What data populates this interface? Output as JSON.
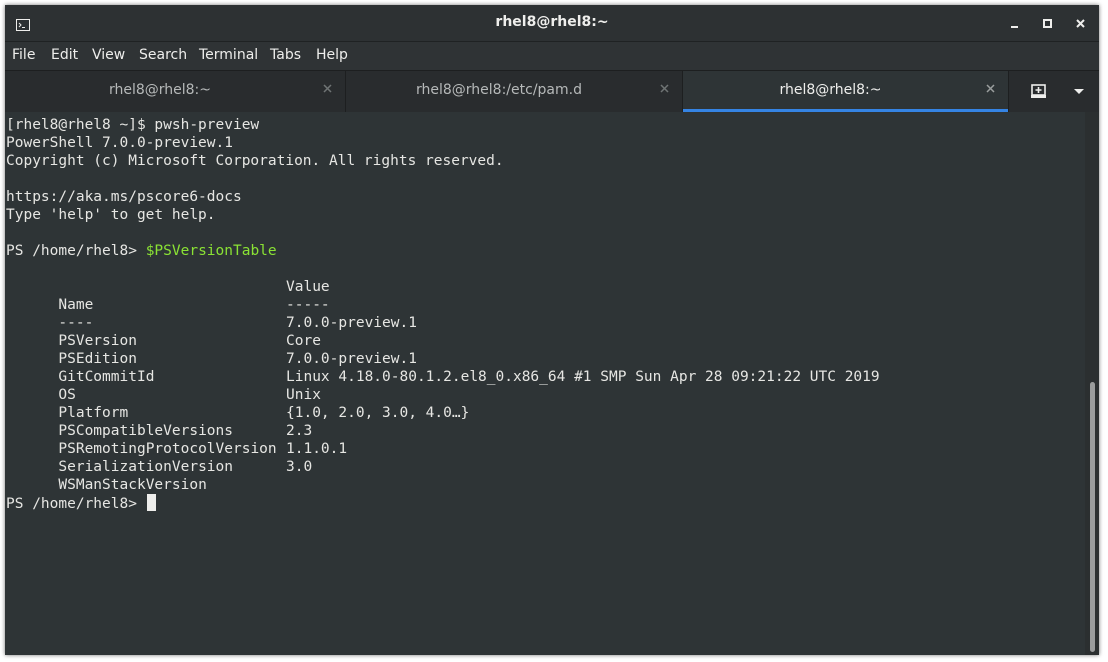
{
  "window": {
    "title": "rhel8@rhel8:~"
  },
  "menu": [
    "File",
    "Edit",
    "View",
    "Search",
    "Terminal",
    "Tabs",
    "Help"
  ],
  "tabs": [
    {
      "label": "rhel8@rhel8:~",
      "active": false
    },
    {
      "label": "rhel8@rhel8:/etc/pam.d",
      "active": false
    },
    {
      "label": "rhel8@rhel8:~",
      "active": true
    }
  ],
  "terminal": {
    "command_line": "[rhel8@rhel8 ~]$ pwsh-preview",
    "banner": [
      "PowerShell 7.0.0-preview.1",
      "Copyright (c) Microsoft Corporation. All rights reserved.",
      "",
      "https://aka.ms/pscore6-docs",
      "Type 'help' to get help."
    ],
    "prompt": "PS /home/rhel8> ",
    "ps_command": "$PSVersionTable",
    "table": {
      "headers": [
        "Name",
        "Value"
      ],
      "separators": [
        "----",
        "-----"
      ],
      "rows": [
        [
          "PSVersion",
          "7.0.0-preview.1"
        ],
        [
          "PSEdition",
          "Core"
        ],
        [
          "GitCommitId",
          "7.0.0-preview.1"
        ],
        [
          "OS",
          "Linux 4.18.0-80.1.2.el8_0.x86_64 #1 SMP Sun Apr 28 09:21:22 UTC 2019"
        ],
        [
          "Platform",
          "Unix"
        ],
        [
          "PSCompatibleVersions",
          "{1.0, 2.0, 3.0, 4.0…}"
        ],
        [
          "PSRemotingProtocolVersion",
          "2.3"
        ],
        [
          "SerializationVersion",
          "1.1.0.1"
        ],
        [
          "WSManStackVersion",
          "3.0"
        ]
      ]
    },
    "final_prompt": "PS /home/rhel8> "
  },
  "colors": {
    "background": "#2e3436",
    "command": "#8ae234",
    "tab_accent": "#3584e4"
  },
  "icons": [
    "terminal-icon",
    "minimize-icon",
    "maximize-icon",
    "close-icon",
    "tab-close-icon",
    "new-tab-icon",
    "tab-menu-icon"
  ]
}
